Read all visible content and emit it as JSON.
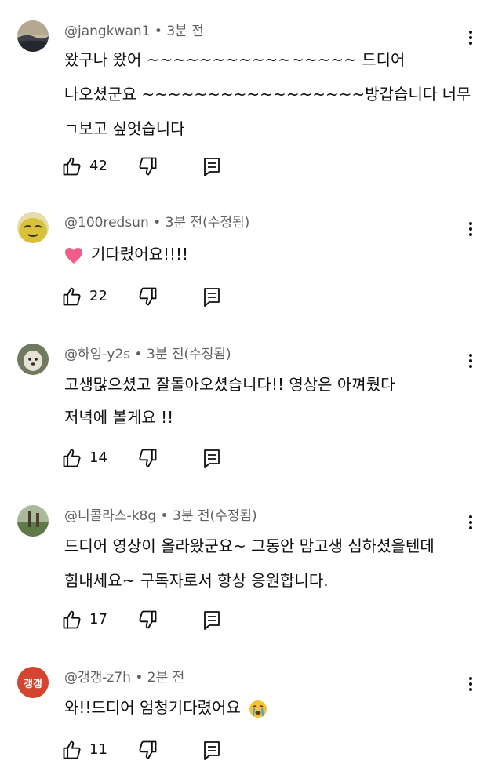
{
  "comments": [
    {
      "handle": "@jangkwan1",
      "sep": " • ",
      "time": "3분 전",
      "edited": "",
      "lines": [
        "왔구나  왔어 ~~~~~~~~~~~~~~~~ 드디어",
        "나오셨군요 ~~~~~~~~~~~~~~~~~방갑습니다 너무",
        "ㄱ보고 싶엇습니다"
      ],
      "likes": "42",
      "avatar_icon": "landscape-avatar",
      "avatar_color": "#4a5060"
    },
    {
      "handle": "@100redsun",
      "sep": " • ",
      "time": "3분 전",
      "edited": "(수정됨)",
      "lines": [
        "기다렸어요!!!!"
      ],
      "emoji": "heart-emoji",
      "likes": "22",
      "avatar_icon": "character-avatar",
      "avatar_color": "#d9c64a"
    },
    {
      "handle": "@하잉-y2s",
      "sep": " • ",
      "time": "3분 전",
      "edited": "(수정됨)",
      "lines": [
        "고생많으셨고 잘돌아오셨습니다!! 영상은 아껴뒀다",
        "저녁에 볼게요 !!"
      ],
      "likes": "14",
      "avatar_icon": "dog-avatar",
      "avatar_color": "#8a9078"
    },
    {
      "handle": "@니콜라스-k8g",
      "sep": " • ",
      "time": "3분 전",
      "edited": "(수정됨)",
      "lines": [
        "드디어 영상이 올라왔군요~ 그동안 맘고생 심하셨을텐데",
        "힘내세요~ 구독자로서 항상 응원합니다."
      ],
      "likes": "17",
      "avatar_icon": "outdoor-avatar",
      "avatar_color": "#6f8a5a"
    },
    {
      "handle": "@갱갱-z7h",
      "sep": " • ",
      "time": "2분 전",
      "edited": "",
      "lines": [
        "와!!드디어 엄청기다렸어요"
      ],
      "trailing_emoji": "crying-face-emoji",
      "likes": "11",
      "avatar_text": "갱갱",
      "avatar_icon": "text-avatar",
      "avatar_color": "#d2452f"
    }
  ]
}
